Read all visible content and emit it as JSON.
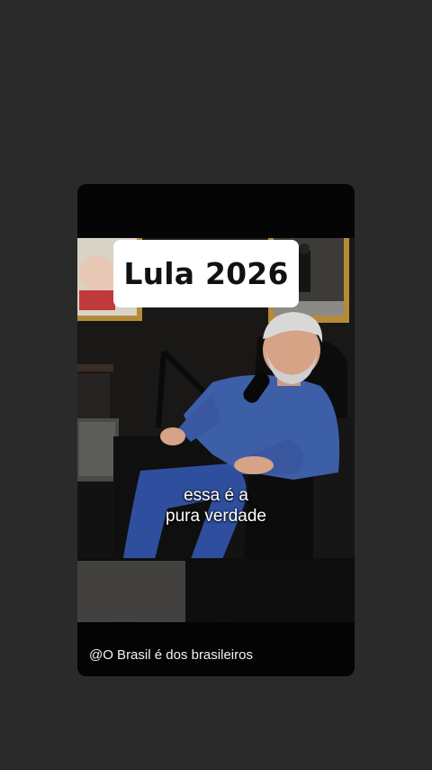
{
  "story": {
    "title_badge": "Lula 2026",
    "caption_lines": [
      "essa é a",
      "pura verdade"
    ],
    "watermark": "@O Brasil é dos brasileiros"
  },
  "colors": {
    "page_background": "#2b2a2a",
    "card_background": "#050505",
    "badge_background": "#ffffff",
    "badge_text": "#111111",
    "caption_text": "#ffffff",
    "shirt_blue": "#3d5fa8",
    "pants_blue": "#2f4f9e"
  }
}
